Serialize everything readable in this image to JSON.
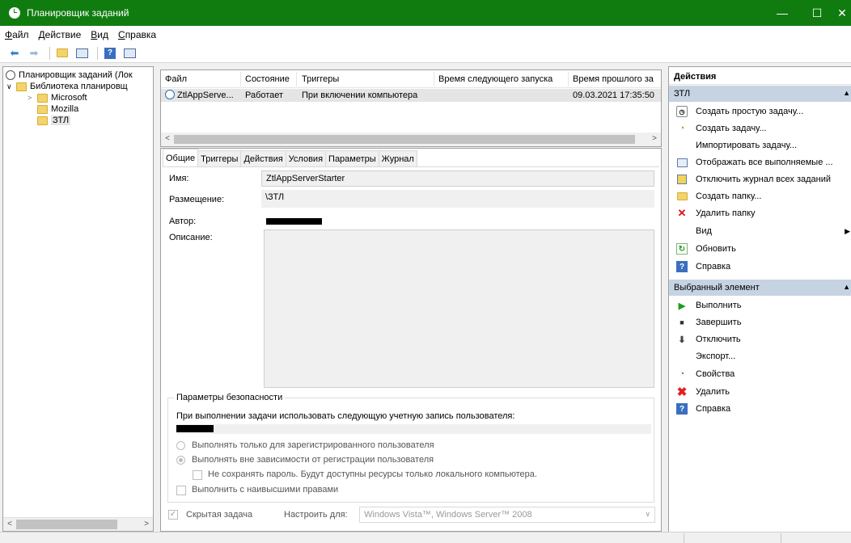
{
  "window": {
    "title": "Планировщик заданий",
    "minimize": "—",
    "maximize": "☐",
    "close": "✕"
  },
  "menu": [
    "Файл",
    "Действие",
    "Вид",
    "Справка"
  ],
  "toolbar_icons": [
    "back-arrow-icon",
    "forward-arrow-icon",
    "folder-up-icon",
    "show-hide-console-tree-icon",
    "help-icon",
    "show-hide-action-pane-icon"
  ],
  "tree": {
    "root": "Планировщик заданий (Лок",
    "library": "Библиотека планировщ",
    "children": [
      "Microsoft",
      "Mozilla",
      "ЗТЛ"
    ]
  },
  "task_list": {
    "columns": [
      "Файл",
      "Состояние",
      "Триггеры",
      "Время следующего запуска",
      "Время прошлого за"
    ],
    "rows": [
      {
        "name": "ZtlAppServe...",
        "state": "Работает",
        "triggers": "При включении компьютера",
        "next": "",
        "last": "09.03.2021 17:35:50"
      }
    ]
  },
  "tabs": [
    "Общие",
    "Триггеры",
    "Действия",
    "Условия",
    "Параметры",
    "Журнал"
  ],
  "general": {
    "name_label": "Имя:",
    "name_value": "ZtlAppServerStarter",
    "location_label": "Размещение:",
    "location_value": "\\ЗТЛ",
    "author_label": "Автор:",
    "description_label": "Описание:"
  },
  "security": {
    "title": "Параметры безопасности",
    "account_text": "При выполнении задачи использовать следующую учетную запись пользователя:",
    "radio1": "Выполнять только для зарегистрированного пользователя",
    "radio2": "Выполнять вне зависимости от регистрации пользователя",
    "no_password": "Не сохранять пароль. Будут доступны ресурсы только локального компьютера.",
    "highest": "Выполнить с наивысшими правами"
  },
  "bottom": {
    "hidden_label": "Скрытая задача",
    "configure_label": "Настроить для:",
    "configure_value": "Windows Vista™, Windows Server™ 2008"
  },
  "actions": {
    "header": "Действия",
    "section1": "ЗТЛ",
    "items1": [
      {
        "label": "Создать простую задачу...",
        "icon": "create-basic-task-icon"
      },
      {
        "label": "Создать задачу...",
        "icon": "create-task-icon"
      },
      {
        "label": "Импортировать задачу...",
        "icon": ""
      },
      {
        "label": "Отображать все выполняемые ...",
        "icon": "running-tasks-icon"
      },
      {
        "label": "Отключить журнал всех заданий",
        "icon": "history-icon"
      },
      {
        "label": "Создать папку...",
        "icon": "new-folder-icon"
      },
      {
        "label": "Удалить папку",
        "icon": "delete-x-icon"
      },
      {
        "label": "Вид",
        "icon": ""
      },
      {
        "label": "Обновить",
        "icon": "refresh-icon"
      },
      {
        "label": "Справка",
        "icon": "help-icon"
      }
    ],
    "section2": "Выбранный элемент",
    "items2": [
      {
        "label": "Выполнить",
        "icon": "run-icon"
      },
      {
        "label": "Завершить",
        "icon": "stop-icon"
      },
      {
        "label": "Отключить",
        "icon": "disable-icon"
      },
      {
        "label": "Экспорт...",
        "icon": ""
      },
      {
        "label": "Свойства",
        "icon": "properties-icon"
      },
      {
        "label": "Удалить",
        "icon": "delete-icon"
      },
      {
        "label": "Справка",
        "icon": "help-icon"
      }
    ]
  },
  "colors": {
    "titlebar": "#107c10",
    "section_header": "#c6d3e2",
    "selected_row": "#e5e5e5"
  }
}
